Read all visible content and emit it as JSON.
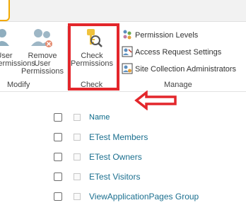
{
  "ribbon": {
    "modify": {
      "user_permissions_line1": "User",
      "user_permissions_line2": "Permissions",
      "remove_user_line1": "Remove User",
      "remove_user_line2": "Permissions",
      "group_label": "Modify"
    },
    "check": {
      "check_line1": "Check",
      "check_line2": "Permissions",
      "group_label": "Check"
    },
    "manage": {
      "items": [
        {
          "label": "Permission Levels",
          "icon": "permission-levels-icon"
        },
        {
          "label": "Access Request Settings",
          "icon": "access-request-icon"
        },
        {
          "label": "Site Collection Administrators",
          "icon": "site-admins-icon"
        }
      ],
      "group_label": "Manage"
    }
  },
  "list": {
    "header": "Name",
    "groups": [
      {
        "name": "ETest Members"
      },
      {
        "name": "ETest Owners"
      },
      {
        "name": "ETest Visitors"
      },
      {
        "name": "ViewApplicationPages Group"
      }
    ]
  },
  "colors": {
    "annotation": "#e3262b",
    "active_tab_accent": "#f2a900",
    "link": "#1b6f8f"
  }
}
